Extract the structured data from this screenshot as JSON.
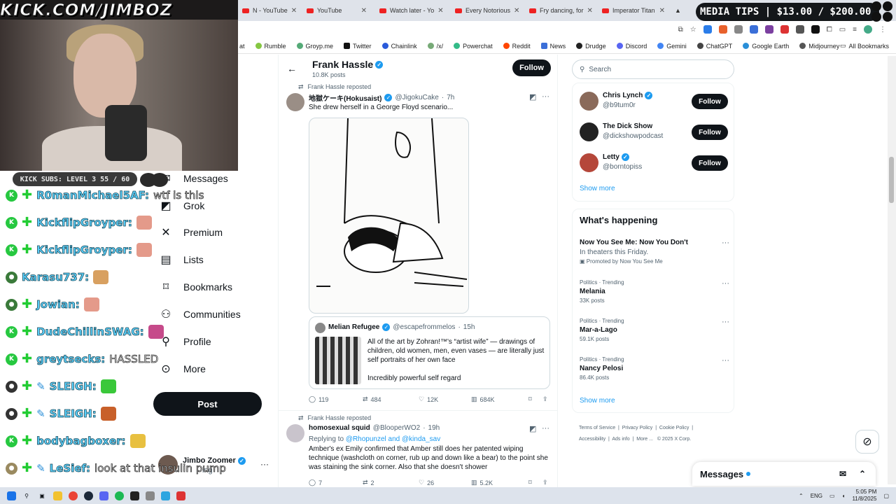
{
  "browser": {
    "tabs": [
      {
        "label": "N - YouTube"
      },
      {
        "label": "YouTube"
      },
      {
        "label": "Watch later - Yo"
      },
      {
        "label": "Every Notorious"
      },
      {
        "label": "Fry dancing, for"
      },
      {
        "label": "Imperator Titan"
      }
    ],
    "bookmarks": [
      "at",
      "Rumble",
      "Groyp.me",
      "Twitter",
      "Chainlink",
      "/x/",
      "Powerchat",
      "Reddit",
      "News",
      "Drudge",
      "Discord",
      "Gemini",
      "ChatGPT",
      "Google Earth",
      "Midjourney"
    ],
    "all_bookmarks": "All Bookmarks"
  },
  "overlay": {
    "url_text": "KICK.COM/JIMBOZ",
    "media_tips": "MEDIA TIPS | $13.00 / $200.00",
    "kick_subs": "KICK SUBS: LEVEL 3 55 / 60",
    "chat": [
      {
        "name": "R0manMichael5AF:",
        "msg": "wtf is this"
      },
      {
        "name": "KickflipGroyper:",
        "msg": ""
      },
      {
        "name": "KickflipGroyper:",
        "msg": ""
      },
      {
        "name": "Karasu737:",
        "msg": ""
      },
      {
        "name": "Jowian:",
        "msg": ""
      },
      {
        "name": "DudeChillinSWAG:",
        "msg": ""
      },
      {
        "name": "greytsecks:",
        "msg": "HASSLED"
      },
      {
        "name": "SLEIGH:",
        "msg": ""
      },
      {
        "name": "SLEIGH:",
        "msg": ""
      },
      {
        "name": "bodybagboxer:",
        "msg": ""
      },
      {
        "name": "LeSief:",
        "msg": "look at that insulin pump"
      }
    ]
  },
  "nav": {
    "items": [
      "Messages",
      "Grok",
      "Premium",
      "Lists",
      "Bookmarks",
      "Communities",
      "Profile",
      "More"
    ],
    "post_label": "Post",
    "account_name": "Jimbo Zoomer",
    "account_handle": "ing"
  },
  "profile": {
    "name": "Frank Hassle",
    "posts": "10.8K posts",
    "follow_label": "Follow"
  },
  "tweets": [
    {
      "repost_label": "Frank Hassle reposted",
      "author": "地獄ケーキ(Hokusaist)",
      "handle": "@JigokuCake",
      "time": "7h",
      "text": "She drew herself in a George Floyd scenario...",
      "quote": {
        "author": "Melian Refugee",
        "handle": "@escapefrommelos",
        "time": "15h",
        "text": "All of the art by Zohran!™'s “artist wife” — drawings of children, old women, men, even vases — are literally just self portraits of her own face",
        "text2": "Incredibly powerful self regard"
      },
      "replies": "119",
      "reposts": "484",
      "likes": "12K",
      "views": "684K"
    },
    {
      "repost_label": "Frank Hassle reposted",
      "author": "homosexual squid",
      "handle": "@BlooperWO2",
      "time": "19h",
      "replying_prefix": "Replying to",
      "replying_to": "@Rhopunzel and @kinda_sav",
      "text": "Amber's ex Emily confirmed that Amber still does her patented wiping technique (washcloth on corner, rub up and down like a bear) to the point she was staining the sink corner. Also that she doesn't shower",
      "replies": "7",
      "reposts": "2",
      "likes": "26",
      "views": "5.2K"
    }
  ],
  "search": {
    "placeholder": "Search"
  },
  "who_to_follow": [
    {
      "name": "Chris Lynch",
      "handle": "@b9tum0r",
      "verified": true
    },
    {
      "name": "The Dick Show",
      "handle": "@dickshowpodcast",
      "verified": false
    },
    {
      "name": "Letty",
      "handle": "@borntopiss",
      "verified": true
    }
  ],
  "show_more": "Show more",
  "happening": {
    "title": "What's happening",
    "trends": [
      {
        "context": "",
        "title": "Now You See Me: Now You Don't",
        "sub": "In theaters this Friday.",
        "count": "Promoted by Now You See Me"
      },
      {
        "context": "Politics · Trending",
        "title": "Melania",
        "sub": "",
        "count": "33K posts"
      },
      {
        "context": "Politics · Trending",
        "title": "Mar-a-Lago",
        "sub": "",
        "count": "59.1K posts"
      },
      {
        "context": "Politics · Trending",
        "title": "Nancy Pelosi",
        "sub": "",
        "count": "86.4K posts"
      }
    ]
  },
  "footer": {
    "line1": [
      "Terms of Service",
      "Privacy Policy",
      "Cookie Policy"
    ],
    "line2": [
      "Accessibility",
      "Ads info",
      "More ...",
      "© 2025 X Corp."
    ]
  },
  "messages_drawer": "Messages",
  "taskbar": {
    "lang": "ENG",
    "time": "5:05 PM",
    "date": "11/8/2025"
  }
}
